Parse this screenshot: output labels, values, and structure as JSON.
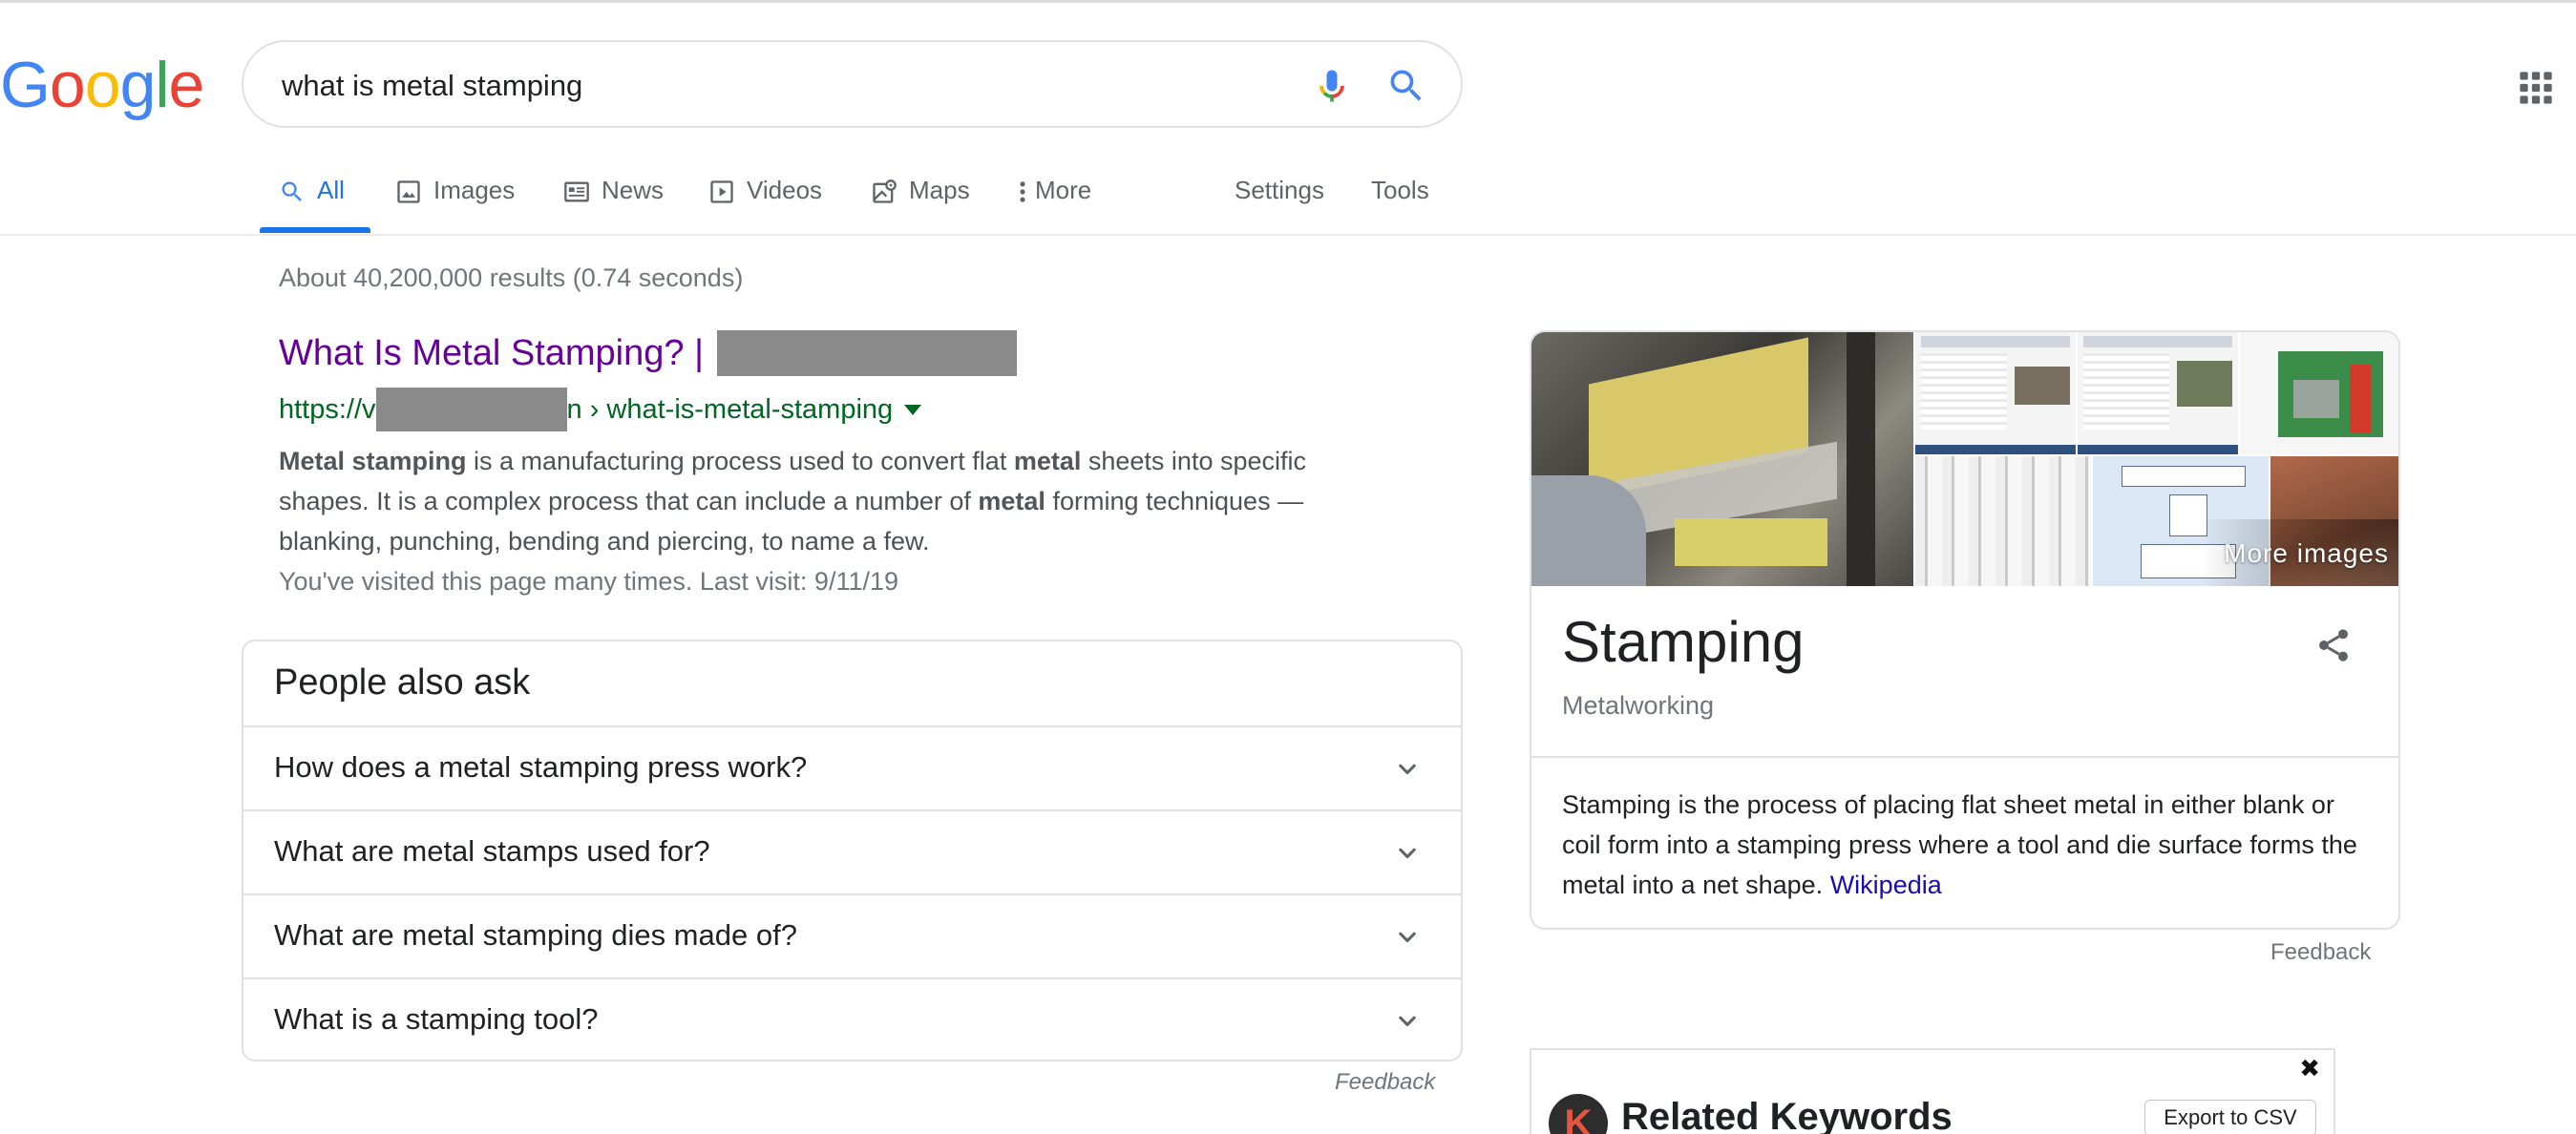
{
  "logo": {
    "letters": [
      "G",
      "o",
      "o",
      "g",
      "l",
      "e"
    ]
  },
  "colors": {
    "g_blue": "#4285F4",
    "g_red": "#EA4335",
    "g_yellow": "#FBBC05",
    "g_green": "#34A853",
    "link_visited": "#660099",
    "url_green": "#006621",
    "tab_active": "#1a73e8",
    "link_blue": "#1a0dab"
  },
  "search": {
    "value": "what is metal stamping",
    "mic_icon": "mic-icon",
    "search_icon": "search-icon"
  },
  "apps_icon": "apps-grid-icon",
  "tabs": [
    {
      "label": "All",
      "icon": "search-icon",
      "active": true
    },
    {
      "label": "Images",
      "icon": "image-icon"
    },
    {
      "label": "News",
      "icon": "news-icon"
    },
    {
      "label": "Videos",
      "icon": "play-icon"
    },
    {
      "label": "Maps",
      "icon": "map-icon"
    },
    {
      "label": "More",
      "icon": "more-vert-icon"
    },
    {
      "label": "Settings"
    },
    {
      "label": "Tools"
    }
  ],
  "result_stats": "About 40,200,000 results (0.74 seconds)",
  "result": {
    "title": "What Is Metal Stamping? |",
    "url_prefix": "https://v",
    "url_mid": "n",
    "url_suffix": "› what-is-metal-stamping",
    "snippet": [
      {
        "t": "Metal stamping",
        "b": true
      },
      {
        "t": " is a manufacturing process used to convert flat ",
        "b": false
      },
      {
        "t": "metal",
        "b": true
      },
      {
        "t": " sheets into specific shapes. It is a complex process that can include a number of ",
        "b": false
      },
      {
        "t": "metal",
        "b": true
      },
      {
        "t": " forming techniques — blanking, punching, bending and piercing, to name a few.",
        "b": false
      }
    ],
    "visited": "You've visited this page many times. Last visit: 9/11/19"
  },
  "people_also_ask": {
    "title": "People also ask",
    "questions": [
      "How does a metal stamping press work?",
      "What are metal stamps used for?",
      "What are metal stamping dies made of?",
      "What is a stamping tool?"
    ],
    "feedback": "Feedback"
  },
  "knowledge_panel": {
    "more_images": "More images",
    "title": "Stamping",
    "subtitle": "Metalworking",
    "description": "Stamping is the process of placing flat sheet metal in either blank or coil form into a stamping press where a tool and die surface forms the metal into a net shape.",
    "source_link": "Wikipedia",
    "share_icon": "share-icon",
    "feedback": "Feedback"
  },
  "related_keywords": {
    "logo_letter": "K",
    "title": "Related Keywords",
    "export_label": "Export to CSV",
    "close_glyph": "✖"
  }
}
